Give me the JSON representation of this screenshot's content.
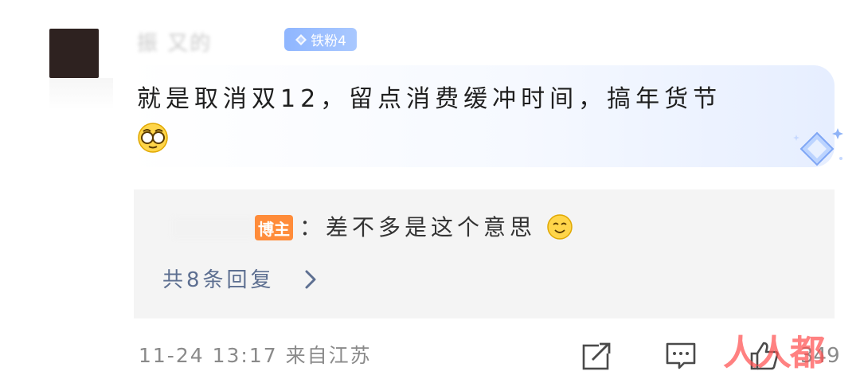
{
  "user": {
    "name": "振 又的",
    "fan_badge": "铁粉4"
  },
  "comment": {
    "text": "就是取消双12，留点消费缓冲时间，搞年货节",
    "emoji": "cry-laugh-emoji"
  },
  "reply": {
    "author_tag": "博主",
    "text": "：差不多是这个意思",
    "emoji": "smile-emoji",
    "reply_count_label": "共8条回复"
  },
  "meta": {
    "time_location": "11-24 13:17 来自江苏",
    "like_count": "349",
    "watermark": "人人都"
  },
  "colors": {
    "badge": "#8fb6ff",
    "blogger_tag": "#ff8c3a",
    "reply_link": "#5d6f91",
    "meta": "#8a8a8a"
  }
}
